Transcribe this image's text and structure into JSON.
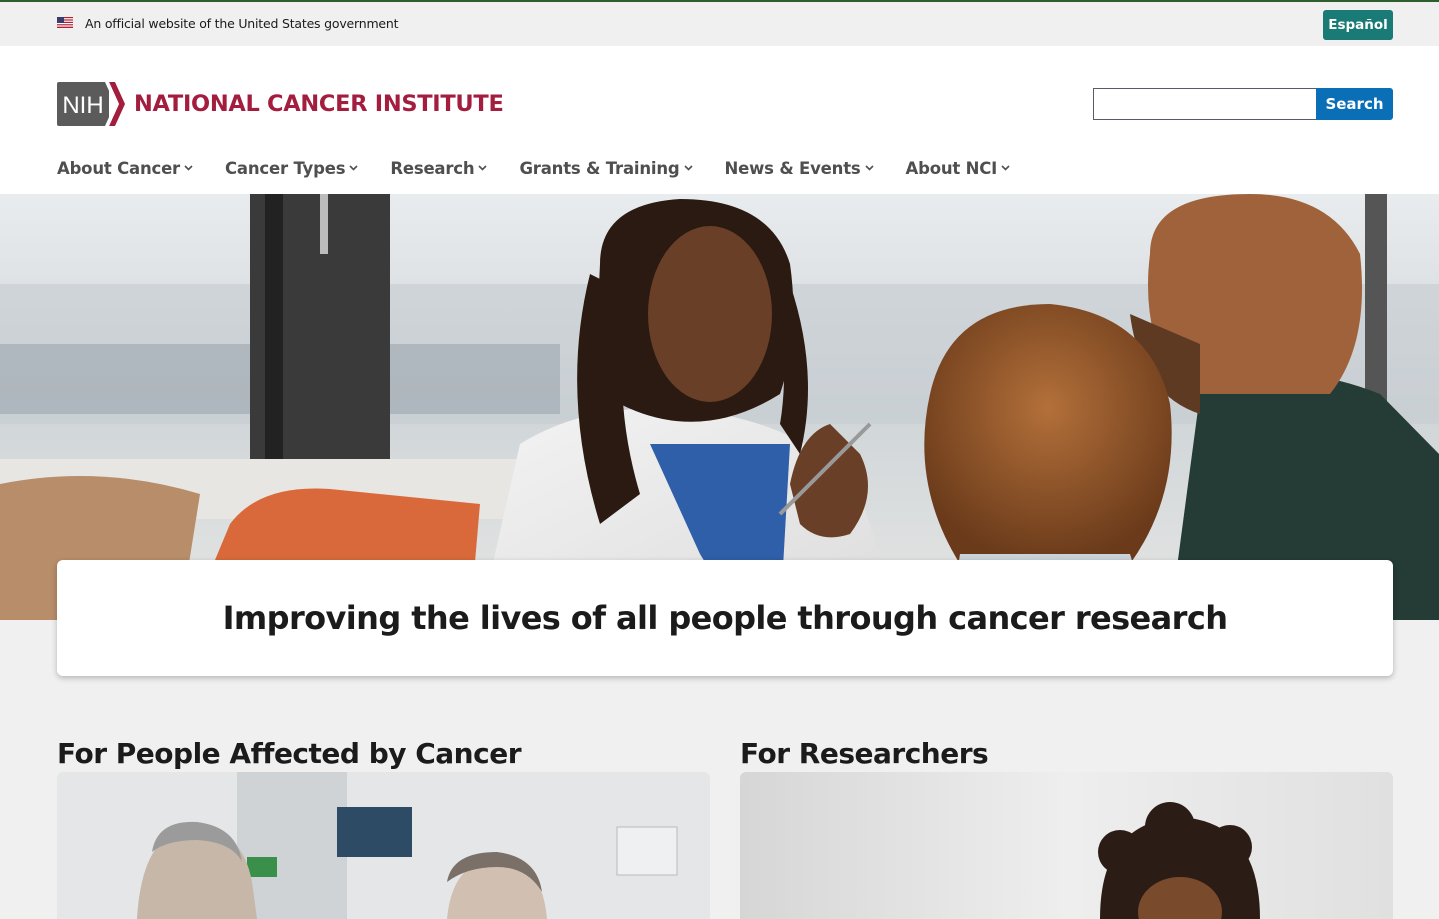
{
  "gov_banner": {
    "official_text": "An official website of the United States government",
    "espanol_label": "Español"
  },
  "header": {
    "logo_mark_text": "NIH",
    "logo_text": "NATIONAL CANCER INSTITUTE",
    "search_placeholder": "",
    "search_button_label": "Search"
  },
  "nav": {
    "items": [
      {
        "label": "About Cancer"
      },
      {
        "label": "Cancer Types"
      },
      {
        "label": "Research"
      },
      {
        "label": "Grants & Training"
      },
      {
        "label": "News & Events"
      },
      {
        "label": "About NCI"
      }
    ]
  },
  "hero": {
    "tagline": "Improving the lives of all people through cancer research"
  },
  "sections": [
    {
      "title": "For People Affected by Cancer"
    },
    {
      "title": "For Researchers"
    }
  ],
  "colors": {
    "brand_red": "#a31d3f",
    "search_blue": "#0b6fb8",
    "espanol_teal": "#1a7a76"
  }
}
